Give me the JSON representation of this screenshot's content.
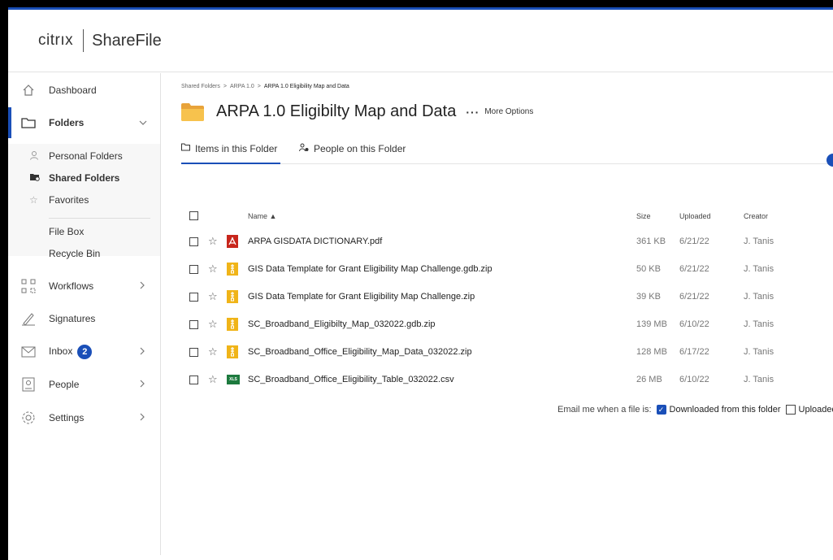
{
  "brand": {
    "citrix": "citrıx",
    "product": "ShareFile",
    "accent": "#1a4fb8"
  },
  "sidebar": {
    "items": [
      {
        "label": "Dashboard",
        "icon": "home-icon"
      },
      {
        "label": "Folders",
        "icon": "folder-icon",
        "chevron": "chevron-down-icon",
        "active": true
      },
      {
        "label": "Workflows",
        "icon": "workflow-icon",
        "chevron": "chevron-right-icon"
      },
      {
        "label": "Signatures",
        "icon": "signature-icon"
      },
      {
        "label": "Inbox",
        "icon": "mail-icon",
        "badge": "2",
        "chevron": "chevron-right-icon"
      },
      {
        "label": "People",
        "icon": "people-icon",
        "chevron": "chevron-right-icon"
      },
      {
        "label": "Settings",
        "icon": "gear-icon",
        "chevron": "chevron-right-icon"
      }
    ],
    "folder_sub": [
      {
        "label": "Personal Folders",
        "icon": "person-icon"
      },
      {
        "label": "Shared Folders",
        "icon": "shared-folder-icon",
        "selected": true
      },
      {
        "label": "Favorites",
        "icon": "star-icon"
      },
      {
        "label": "File Box"
      },
      {
        "label": "Recycle Bin"
      }
    ]
  },
  "main": {
    "breadcrumb": [
      "Shared Folders",
      "ARPA 1.0",
      "ARPA 1.0 Eligibility Map and Data"
    ],
    "breadcrumb_sep": ">",
    "title": "ARPA 1.0 Eligibilty Map and Data",
    "more_dots": "···",
    "more_label": "More Options",
    "tabs": [
      {
        "label": "Items in this Folder",
        "active": true
      },
      {
        "label": "People on this Folder"
      }
    ]
  },
  "table": {
    "headers": {
      "name": "Name ▲",
      "size": "Size",
      "uploaded": "Uploaded",
      "creator": "Creator"
    },
    "rows": [
      {
        "type": "pdf",
        "name": "ARPA GISDATA DICTIONARY.pdf",
        "size": "361 KB",
        "uploaded": "6/21/22",
        "creator": "J. Tanis"
      },
      {
        "type": "zip",
        "name": "GIS Data Template for Grant Eligibility Map Challenge.gdb.zip",
        "size": "50 KB",
        "uploaded": "6/21/22",
        "creator": "J. Tanis"
      },
      {
        "type": "zip",
        "name": "GIS Data Template for Grant Eligibility Map Challenge.zip",
        "size": "39 KB",
        "uploaded": "6/21/22",
        "creator": "J. Tanis"
      },
      {
        "type": "zip",
        "name": "SC_Broadband_Eligibilty_Map_032022.gdb.zip",
        "size": "139 MB",
        "uploaded": "6/10/22",
        "creator": "J. Tanis"
      },
      {
        "type": "zip",
        "name": "SC_Broadband_Office_Eligibility_Map_Data_032022.zip",
        "size": "128 MB",
        "uploaded": "6/17/22",
        "creator": "J. Tanis"
      },
      {
        "type": "xls",
        "name": "SC_Broadband_Office_Eligibility_Table_032022.csv",
        "size": "26 MB",
        "uploaded": "6/10/22",
        "creator": "J. Tanis"
      }
    ]
  },
  "email": {
    "prefix": "Email me when a file is:",
    "option1": "Downloaded from this folder",
    "option1_checked": true,
    "option2": "Uploaded to"
  }
}
